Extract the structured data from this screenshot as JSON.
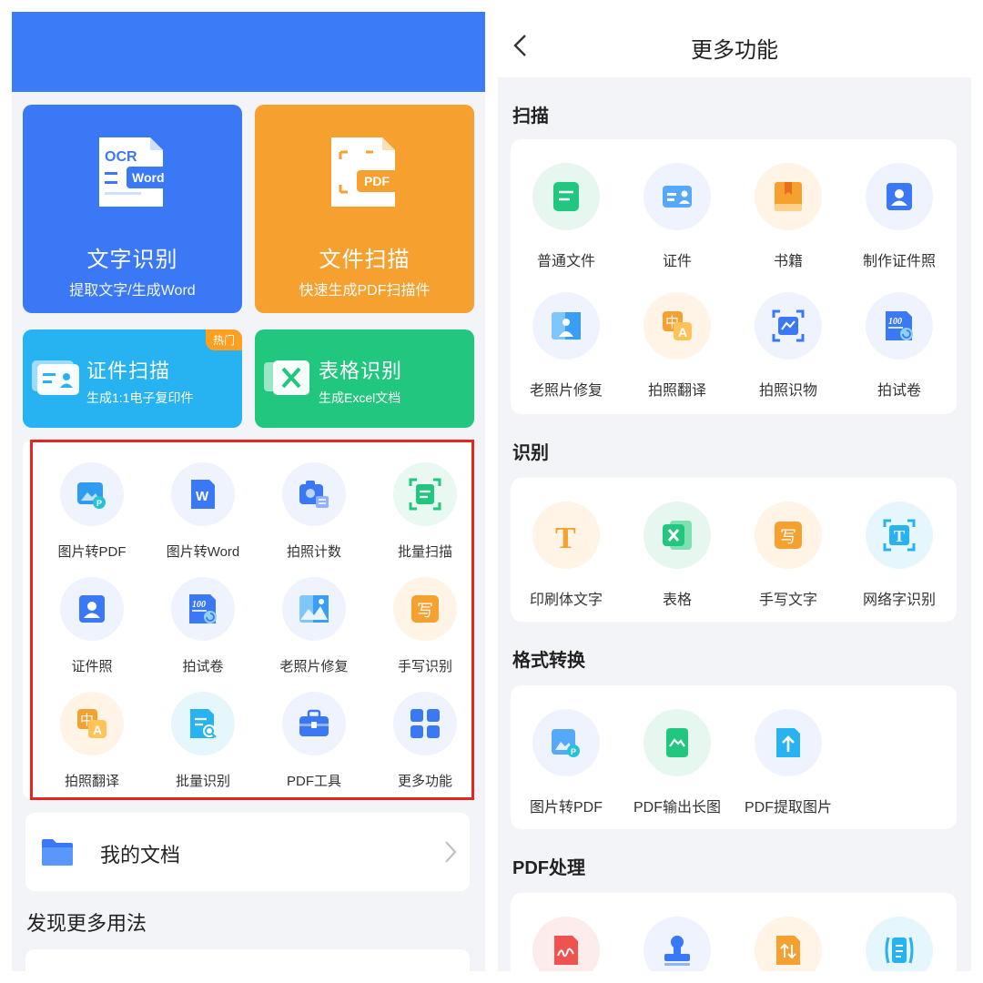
{
  "left": {
    "cards": {
      "ocr": {
        "badge_top": "OCR",
        "badge": "Word",
        "title": "文字识别",
        "subtitle": "提取文字/生成Word"
      },
      "scan": {
        "badge": "PDF",
        "title": "文件扫描",
        "subtitle": "快速生成PDF扫描件"
      },
      "id": {
        "hot": "热门",
        "title": "证件扫描",
        "subtitle": "生成1:1电子复印件"
      },
      "table": {
        "title": "表格识别",
        "subtitle": "生成Excel文档"
      }
    },
    "grid": [
      {
        "label": "图片转PDF",
        "icon": "image-to-pdf-icon"
      },
      {
        "label": "图片转Word",
        "icon": "word-icon"
      },
      {
        "label": "拍照计数",
        "icon": "camera-count-icon"
      },
      {
        "label": "批量扫描",
        "icon": "batch-scan-icon"
      },
      {
        "label": "证件照",
        "icon": "id-photo-icon"
      },
      {
        "label": "拍试卷",
        "icon": "exam-paper-icon"
      },
      {
        "label": "老照片修复",
        "icon": "photo-restore-icon"
      },
      {
        "label": "手写识别",
        "icon": "handwriting-icon"
      },
      {
        "label": "拍照翻译",
        "icon": "translate-icon"
      },
      {
        "label": "批量识别",
        "icon": "batch-recognize-icon"
      },
      {
        "label": "PDF工具",
        "icon": "pdf-tools-icon"
      },
      {
        "label": "更多功能",
        "icon": "more-icon"
      }
    ],
    "my_docs": "我的文档",
    "discover": "发现更多用法"
  },
  "right": {
    "title": "更多功能",
    "sections": {
      "scan": {
        "title": "扫描",
        "items": [
          {
            "label": "普通文件",
            "icon": "document-icon"
          },
          {
            "label": "证件",
            "icon": "id-card-icon"
          },
          {
            "label": "书籍",
            "icon": "book-icon"
          },
          {
            "label": "制作证件照",
            "icon": "id-photo-icon"
          },
          {
            "label": "老照片修复",
            "icon": "photo-restore-icon"
          },
          {
            "label": "拍照翻译",
            "icon": "translate-icon"
          },
          {
            "label": "拍照识物",
            "icon": "object-recognize-icon"
          },
          {
            "label": "拍试卷",
            "icon": "exam-paper-icon"
          }
        ]
      },
      "recognize": {
        "title": "识别",
        "items": [
          {
            "label": "印刷体文字",
            "icon": "print-text-icon"
          },
          {
            "label": "表格",
            "icon": "excel-icon"
          },
          {
            "label": "手写文字",
            "icon": "handwriting-icon"
          },
          {
            "label": "网络字识别",
            "icon": "web-text-icon"
          }
        ]
      },
      "convert": {
        "title": "格式转换",
        "items": [
          {
            "label": "图片转PDF",
            "icon": "image-to-pdf-icon"
          },
          {
            "label": "PDF输出长图",
            "icon": "pdf-long-image-icon"
          },
          {
            "label": "PDF提取图片",
            "icon": "pdf-extract-image-icon"
          }
        ]
      },
      "pdf": {
        "title": "PDF处理",
        "items": [
          {
            "label": "",
            "icon": "pdf-sign-icon"
          },
          {
            "label": "",
            "icon": "stamp-icon"
          },
          {
            "label": "",
            "icon": "pdf-sort-icon"
          },
          {
            "label": "",
            "icon": "pdf-compress-icon"
          }
        ]
      }
    }
  },
  "colors": {
    "header_blue": "#3b7bf8",
    "ocr_blue": "#3a78f6",
    "scan_orange": "#f6a030",
    "id_cyan": "#27b3f2",
    "table_green": "#22c77f",
    "highlight_red": "#e8241f",
    "hot_badge": "#ff9f1f"
  }
}
